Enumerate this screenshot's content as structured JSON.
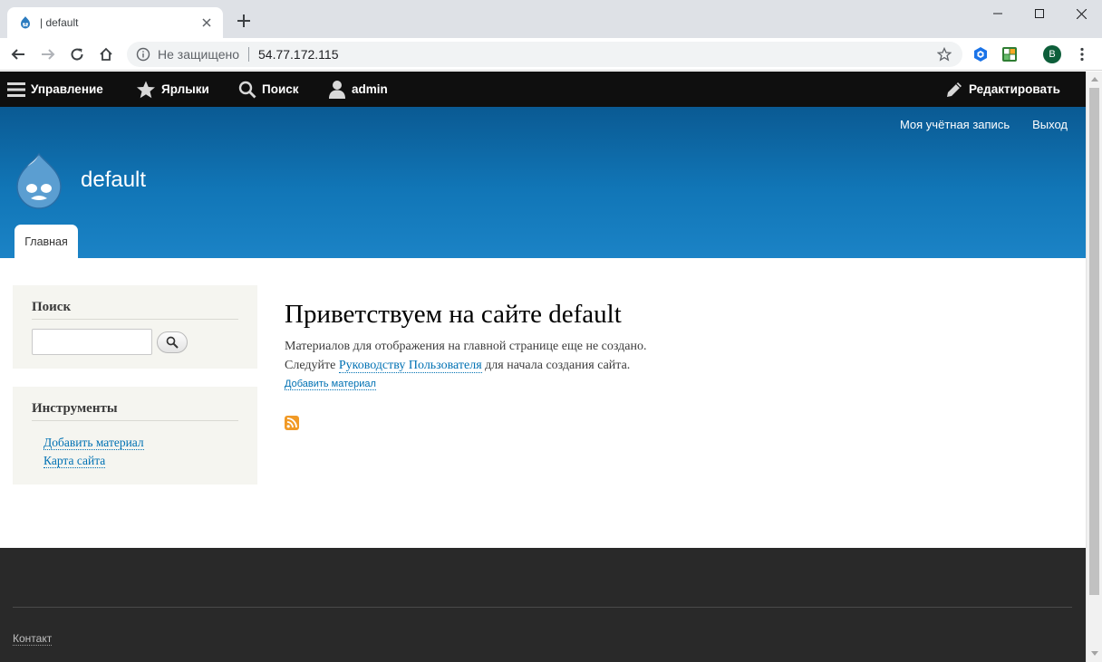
{
  "browser": {
    "tab_title": "| default",
    "security_text": "Не защищено",
    "url": "54.77.172.115",
    "profile_initial": "B"
  },
  "admin_toolbar": {
    "manage": "Управление",
    "shortcuts": "Ярлыки",
    "search": "Поиск",
    "user": "admin",
    "edit": "Редактировать"
  },
  "header": {
    "secondary_menu": [
      "Моя учётная запись",
      "Выход"
    ],
    "site_name": "default",
    "main_tab": "Главная"
  },
  "sidebar": {
    "search_block": {
      "title": "Поиск",
      "input_value": ""
    },
    "tools_block": {
      "title": "Инструменты",
      "links": [
        "Добавить материал",
        "Карта сайта"
      ]
    }
  },
  "main": {
    "title": "Приветствуем на сайте default",
    "line1": "Материалов для отображения на главной странице еще не создано.",
    "line2_before": "Следуйте ",
    "line2_link": "Руководству Пользователя",
    "line2_after": " для начала создания сайта.",
    "add_content_link": "Добавить материал"
  },
  "footer": {
    "contact": "Контакт"
  },
  "colors": {
    "header_top": "#0a5a93",
    "header_bottom": "#1b83c6",
    "link": "#0071b3",
    "admin_bar": "#0f0f0f",
    "footer": "#292929"
  }
}
